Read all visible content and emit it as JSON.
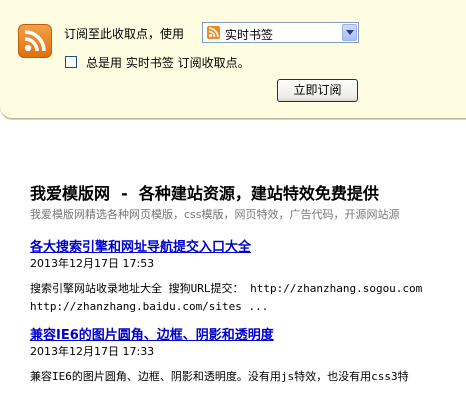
{
  "subscribe_bar": {
    "label": "订阅至此收取点，使用",
    "reader_select": {
      "value": "实时书签"
    },
    "always_use_label": "总是用 实时书签 订阅收取点。",
    "always_use_checked": false,
    "subscribe_button": "立即订阅"
  },
  "feed": {
    "title": "我爱模版网 - 各种建站资源，建站特效免费提供",
    "description": "我爱模版网精选各种网页模版，css模版，网页特效，广告代码，开源网站源",
    "items": [
      {
        "title": "各大搜索引擎和网址导航提交入口大全",
        "date": "2013年12月17日 17:53",
        "body_line1": "搜索引擎网站收录地址大全 搜狗URL提交： http://zhanzhang.sogou.com",
        "body_line2": "http://zhanzhang.baidu.com/sites ..."
      },
      {
        "title": "兼容IE6的图片圆角、边框、阴影和透明度",
        "date": "2013年12月17日 17:33",
        "body_line1": "兼容IE6的图片圆角、边框、阴影和透明度。没有用js特效，也没有用css3特"
      }
    ]
  }
}
